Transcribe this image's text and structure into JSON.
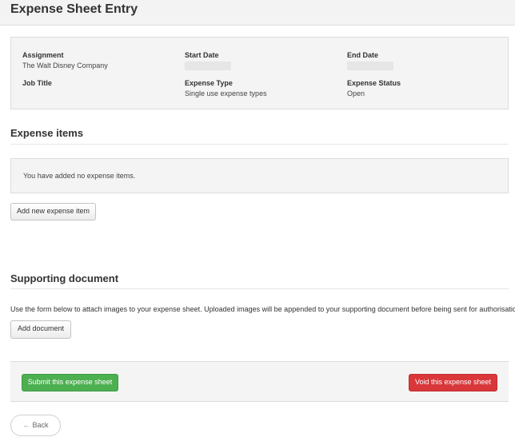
{
  "header": {
    "title": "Expense Sheet Entry"
  },
  "summary": {
    "assignment_label": "Assignment",
    "assignment_value": "The Walt Disney Company",
    "start_date_label": "Start Date",
    "end_date_label": "End Date",
    "job_title_label": "Job Title",
    "expense_type_label": "Expense Type",
    "expense_type_value": "Single use expense types",
    "expense_status_label": "Expense Status",
    "expense_status_value": "Open"
  },
  "expense_items": {
    "title": "Expense items",
    "empty_message": "You have added no expense items.",
    "add_button": "Add new expense item"
  },
  "supporting_document": {
    "title": "Supporting document",
    "description": "Use the form below to attach images to your expense sheet. Uploaded images will be appended to your supporting document before being sent for authorisation.",
    "add_button": "Add document"
  },
  "actions": {
    "submit_button": "Submit this expense sheet",
    "void_button": "Void this expense sheet",
    "back_button": "Back",
    "back_icon": "arrow-left-icon"
  },
  "colors": {
    "submit": "#4caf50",
    "void": "#d9373a",
    "panel_bg": "#f4f4f4"
  }
}
